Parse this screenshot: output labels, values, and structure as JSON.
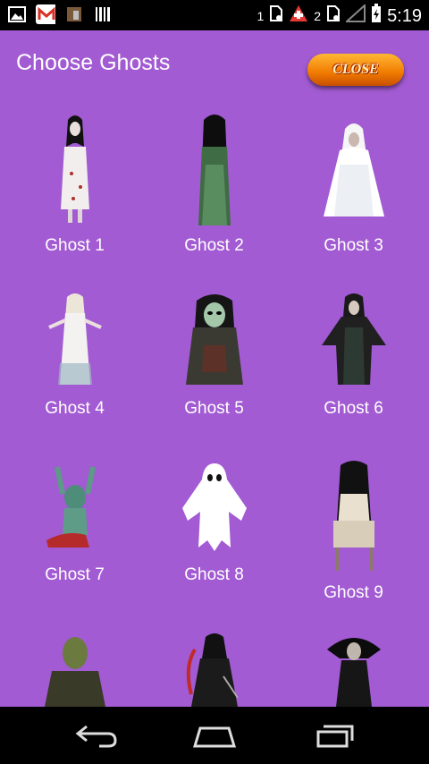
{
  "status_bar": {
    "sim1_label": "1",
    "sim2_label": "2",
    "time": "5:19"
  },
  "header": {
    "title": "Choose Ghosts",
    "close_label": "CLOSE"
  },
  "ghosts": [
    {
      "label": "Ghost 1"
    },
    {
      "label": "Ghost 2"
    },
    {
      "label": "Ghost 3"
    },
    {
      "label": "Ghost 4"
    },
    {
      "label": "Ghost 5"
    },
    {
      "label": "Ghost 6"
    },
    {
      "label": "Ghost 7"
    },
    {
      "label": "Ghost 8"
    },
    {
      "label": "Ghost 9"
    },
    {
      "label": ""
    },
    {
      "label": ""
    },
    {
      "label": ""
    }
  ],
  "colors": {
    "background": "#a25bd2",
    "close_button": "#f07a00"
  },
  "nav_icons": [
    "back-icon",
    "home-icon",
    "recent-apps-icon"
  ]
}
